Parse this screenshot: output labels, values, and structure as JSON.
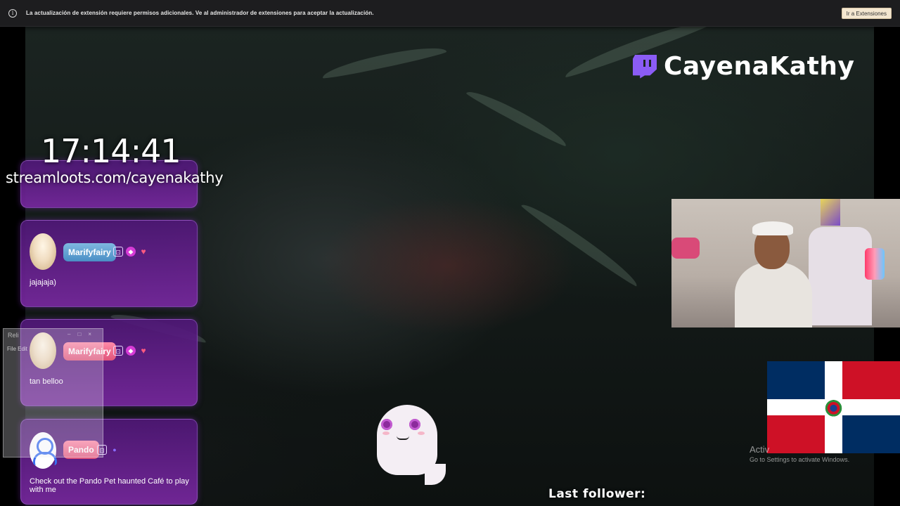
{
  "notification": {
    "message": "La actualización de extensión requiere permisos adicionales. Ve al administrador de extensiones para aceptar la actualización.",
    "button_label": "Ir a Extensiones",
    "info_icon": "i"
  },
  "overlay": {
    "channel_name": "CayenaKathy",
    "clock": "17:14:41",
    "streamloots": "streamloots.com/cayenakathy",
    "last_follower_label": "Last follower:"
  },
  "chat": {
    "messages": [
      {
        "user": "Marifyfairy",
        "text": "jajajaja)"
      },
      {
        "user": "Marifyfairy",
        "text": "tan belloo"
      },
      {
        "user": "Pando",
        "text": "Check out the Pando Pet haunted Café to play with me"
      }
    ]
  },
  "ghost_window": {
    "title": "Reli",
    "menu": "File  Edit",
    "pill": "Pando",
    "text": "Check out the Pando Pet haunted Café to play with me"
  },
  "windows_watermark": {
    "line1": "Activ",
    "line2": "Go to Settings to activate Windows."
  },
  "colors": {
    "accent_twitch": "#8b5cf6",
    "flag_blue": "#002d62",
    "flag_red": "#ce1126",
    "chat_card": "#6a1f9a"
  },
  "icons": {
    "twitch": "twitch-logo-icon",
    "info": "info-icon",
    "gem_badge": "gem-icon",
    "heart_badge": "heart-icon"
  }
}
